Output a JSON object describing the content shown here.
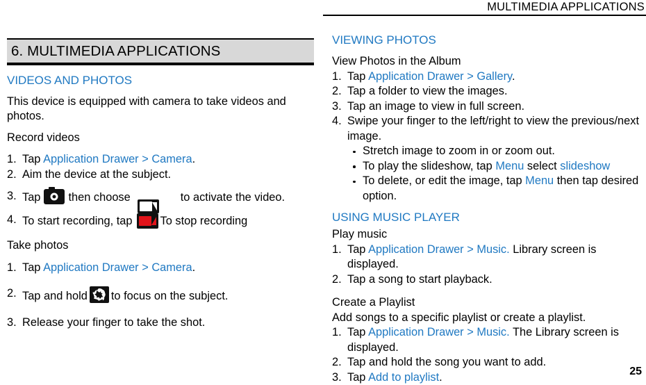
{
  "page": {
    "running_header": "MULTIMEDIA APPLICATIONS",
    "page_number": "25",
    "accent_color": "#2079c2",
    "banner_bg": "#d8d8d8",
    "record_icon_color": "#e2131a"
  },
  "chapter": {
    "title": "6. MULTIMEDIA APPLICATIONS"
  },
  "left_column": {
    "section_heading": "VIDEOS AND PHOTOS",
    "intro": "This device is equipped with camera to take videos and photos.",
    "record_videos": {
      "subheading": "Record videos",
      "step1_num": "1.",
      "step1_pre": "Tap ",
      "step1_link": "Application Drawer > Camera",
      "step1_post": ".",
      "step2_num": "2.",
      "step2_text": "Aim the device at the subject.",
      "step3_num": "3.",
      "step3_pre": "Tap",
      "step3_mid": "then choose",
      "step3_post": "to activate the video.",
      "step3_icon": "camera-icon",
      "step3_icon2": "camcorder-white-icon",
      "step4_num": "4.",
      "step4_pre": "To start recording, tap",
      "step4_post": "To stop recording",
      "step4_icon": "camcorder-red-icon"
    },
    "take_photos": {
      "subheading": "Take photos",
      "step1_num": "1.",
      "step1_pre": "Tap ",
      "step1_link": "Application Drawer > Camera",
      "step1_post": ".",
      "step2_num": "2.",
      "step2_pre": "Tap and hold",
      "step2_post": "to focus on the subject.",
      "step2_icon": "aperture-icon",
      "step3_num": "3.",
      "step3_text": "Release your finger to take the shot."
    }
  },
  "right_column": {
    "viewing_photos": {
      "heading": "VIEWING PHOTOS",
      "subheading": "View Photos in the Album",
      "step1_num": "1.",
      "step1_pre": "Tap ",
      "step1_link": "Application Drawer > Gallery",
      "step1_post": ".",
      "step2_num": "2.",
      "step2_text": "Tap a folder to view the images.",
      "step3_num": "3.",
      "step3_text": "Tap an image to view in full screen.",
      "step4_num": "4.",
      "step4_text": "Swipe your finger to the left/right to view the previous/next image.",
      "bullet1": "Stretch image to zoom in or zoom out.",
      "bullet2_pre": "To play the slideshow, tap ",
      "bullet2_link1": "Menu",
      "bullet2_mid": " select ",
      "bullet2_link2": "slideshow",
      "bullet3_pre": "To delete, or edit the image, tap ",
      "bullet3_link": "Menu",
      "bullet3_post": " then tap desired option."
    },
    "music_player": {
      "heading": "USING MUSIC PLAYER",
      "play_music": {
        "subheading": "Play music",
        "step1_num": "1.",
        "step1_pre": "Tap ",
        "step1_link": "Application Drawer > Music.",
        "step1_post": " Library screen is displayed.",
        "step2_num": "2.",
        "step2_text": "Tap a song to start playback."
      },
      "create_playlist": {
        "subheading": "Create a Playlist",
        "description": "Add songs to a specific playlist or create a playlist.",
        "step1_num": "1.",
        "step1_pre": "Tap ",
        "step1_link": "Application Drawer > Music.",
        "step1_post": " The Library screen is displayed.",
        "step2_num": "2.",
        "step2_text": "Tap and hold the song you want to add.",
        "step3_num": "3.",
        "step3_pre": "Tap ",
        "step3_link": "Add to playlist",
        "step3_post": "."
      }
    }
  }
}
